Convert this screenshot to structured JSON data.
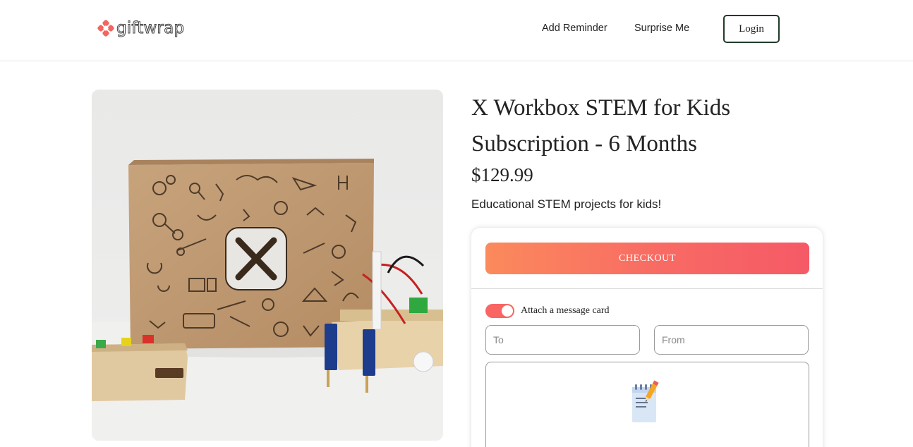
{
  "header": {
    "logo_text": "giftwrap",
    "nav": {
      "add_reminder": "Add Reminder",
      "surprise_me": "Surprise Me",
      "login": "Login"
    }
  },
  "product": {
    "title": "X Workbox STEM for Kids Subscription - 6 Months",
    "price": "$129.99",
    "tagline": "Educational STEM projects for kids!",
    "image_alt": "X Workbox STEM box with robot kit"
  },
  "checkout": {
    "button_label": "CHECKOUT",
    "message_card_label": "Attach a message card",
    "message_card_enabled": true,
    "to_placeholder": "To",
    "from_placeholder": "From",
    "message_icon": "notepad-pencil-icon"
  },
  "colors": {
    "accent": "#f86563",
    "checkout_gradient_start": "#fb8a5c",
    "checkout_gradient_end": "#f55a66",
    "login_border": "#1f3b2a",
    "logo_mark": "#f4655f"
  }
}
